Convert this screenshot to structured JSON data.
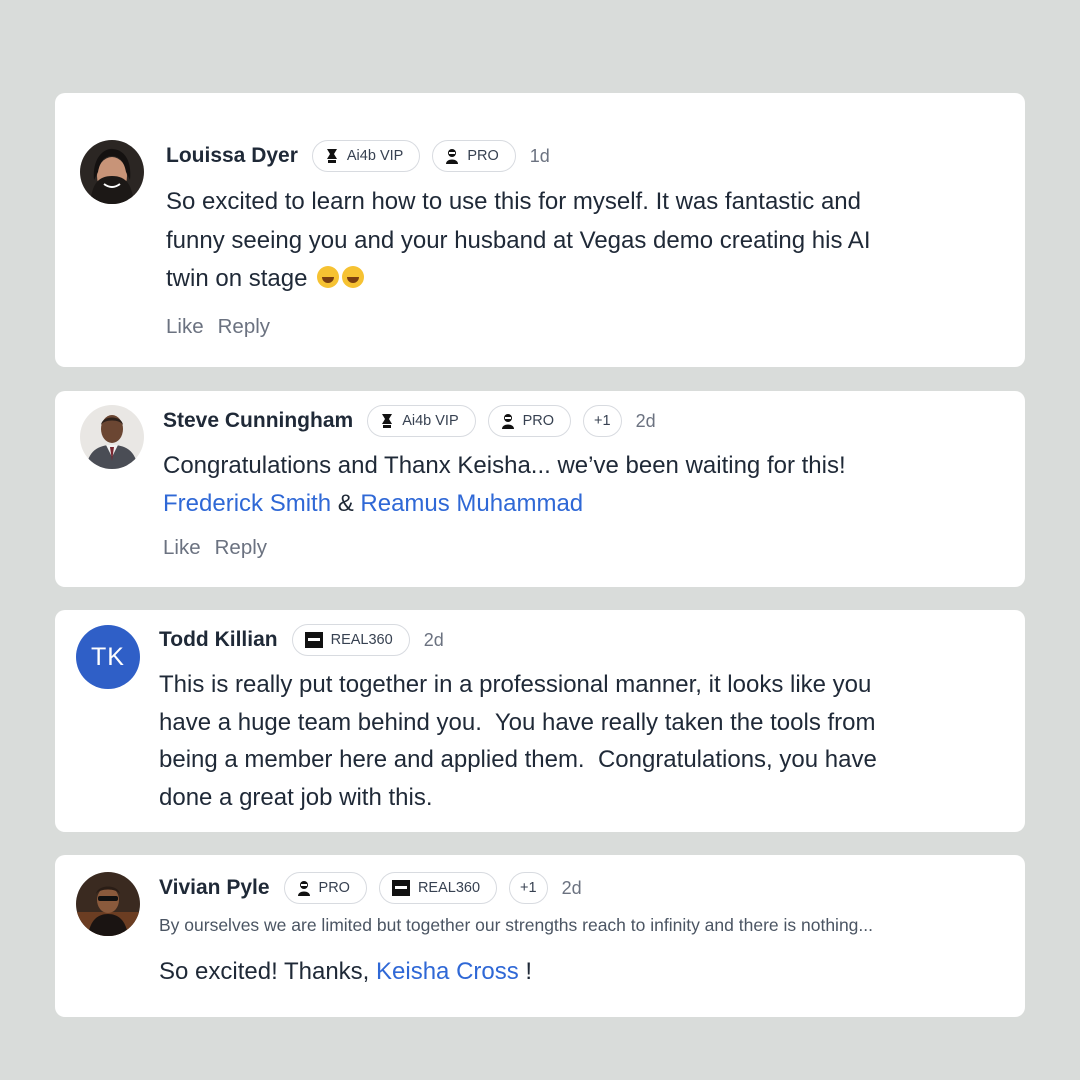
{
  "comments": [
    {
      "name": "Louissa Dyer",
      "badges": [
        "Ai4b VIP",
        "PRO"
      ],
      "time": "1d",
      "lines": [
        "So excited to learn how to use this for myself. It was fantastic and",
        "funny seeing you and your husband at Vegas demo creating his AI",
        "twin on stage"
      ],
      "emoji": [
        "rolling-on-floor-laughing-emoji",
        "rolling-on-floor-laughing-emoji"
      ],
      "actions": [
        "Like",
        "Reply"
      ]
    },
    {
      "name": "Steve Cunningham",
      "badges": [
        "Ai4b VIP",
        "PRO"
      ],
      "extra_badges": "+1",
      "time": "2d",
      "line1": "Congratulations and Thanx Keisha... we’ve been waiting for this!",
      "mention1": "Frederick Smith",
      "joiner": " & ",
      "mention2": "Reamus Muhammad",
      "actions": [
        "Like",
        "Reply"
      ]
    },
    {
      "name": "Todd Killian",
      "initials": "TK",
      "badges": [
        "REAL360"
      ],
      "time": "2d",
      "lines": [
        "This is really put together in a professional manner, it looks like you",
        "have a huge team behind you.  You have really taken the tools from",
        "being a member here and applied them.  Congratulations, you have",
        "done a great job with this."
      ]
    },
    {
      "name": "Vivian Pyle",
      "badges": [
        "PRO",
        "REAL360"
      ],
      "extra_badges": "+1",
      "time": "2d",
      "bio": "By ourselves we are limited but together our strengths reach to infinity and there is nothing...",
      "text_before": "So excited! Thanks, ",
      "mention": "Keisha Cross",
      "text_after": " !"
    }
  ],
  "colors": {
    "background": "#d9dcda",
    "card": "#ffffff",
    "link": "#2f68d6",
    "initials_avatar": "#2f5fc7"
  }
}
